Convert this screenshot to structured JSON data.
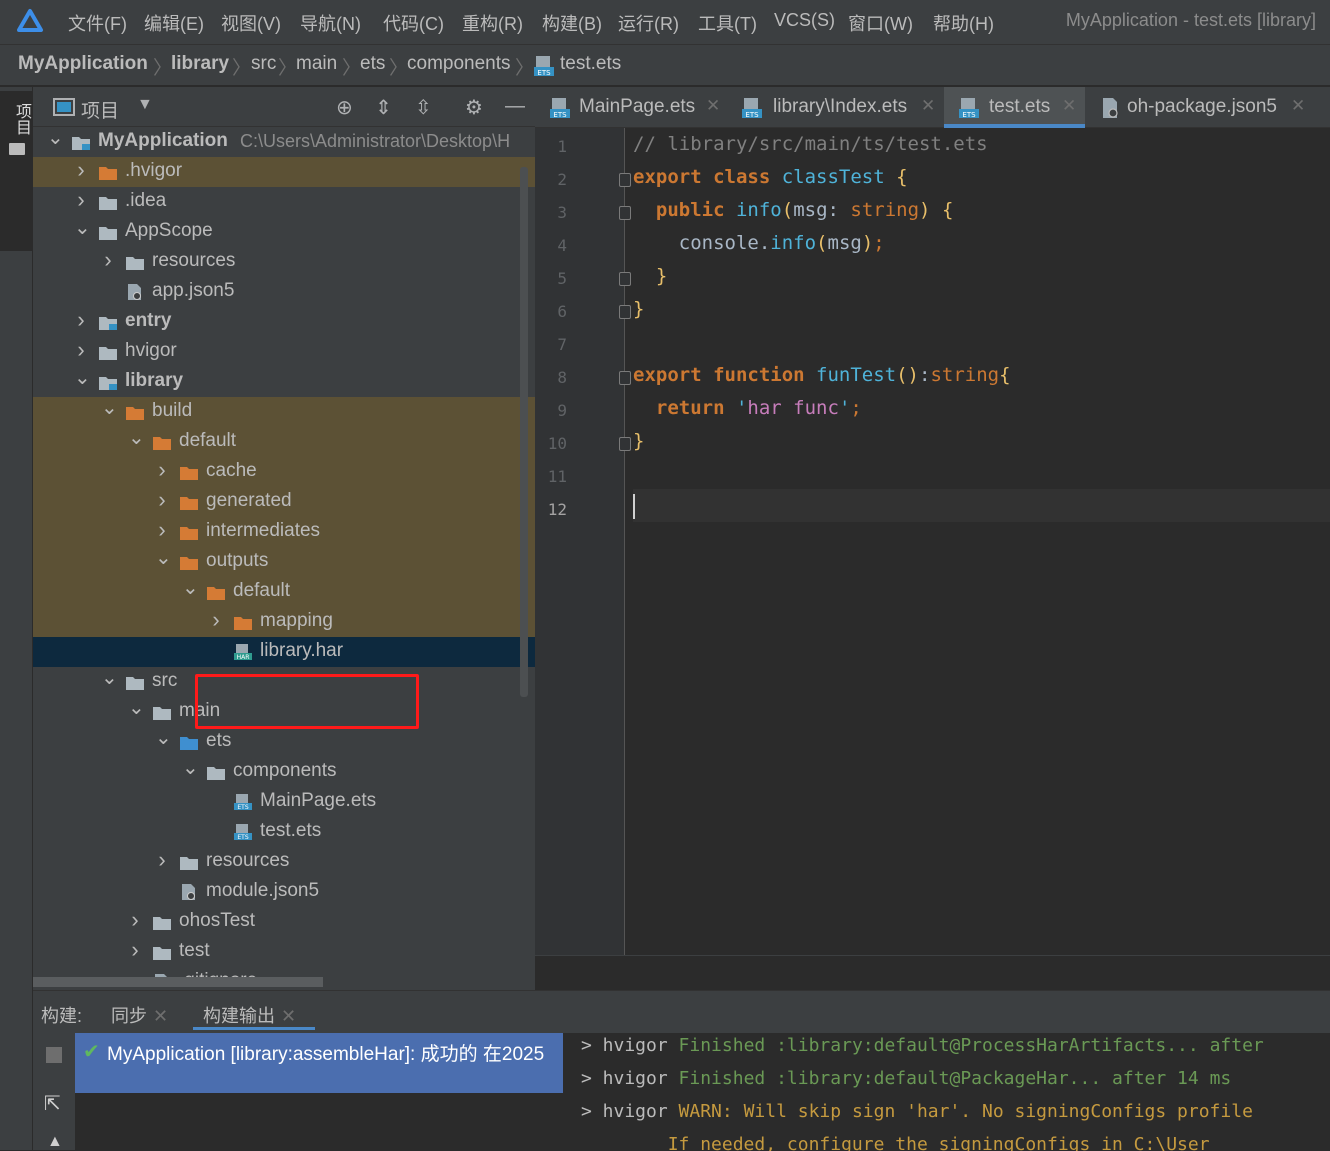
{
  "menubar": {
    "items": [
      "文件(F)",
      "编辑(E)",
      "视图(V)",
      "导航(N)",
      "代码(C)",
      "重构(R)",
      "构建(B)",
      "运行(R)",
      "工具(T)",
      "VCS(S)",
      "窗口(W)",
      "帮助(H)"
    ],
    "window_title": "MyApplication - test.ets [library]"
  },
  "breadcrumb": [
    "MyApplication",
    "library",
    "src",
    "main",
    "ets",
    "components",
    "test.ets"
  ],
  "sidebar_strip": {
    "label": "项目"
  },
  "project_panel": {
    "title": "项目",
    "tree": [
      {
        "name": "MyApplication",
        "path": "C:\\Users\\Administrator\\Desktop\\H",
        "expanded": true,
        "bold": true,
        "icon": "module-folder"
      },
      {
        "name": ".hvigor",
        "expanded": false,
        "icon": "folder-orange"
      },
      {
        "name": ".idea",
        "expanded": false,
        "icon": "folder"
      },
      {
        "name": "AppScope",
        "expanded": true,
        "icon": "folder"
      },
      {
        "name": "resources",
        "expanded": false,
        "icon": "folder"
      },
      {
        "name": "app.json5",
        "icon": "json-file"
      },
      {
        "name": "entry",
        "expanded": false,
        "bold": true,
        "icon": "module-folder"
      },
      {
        "name": "hvigor",
        "expanded": false,
        "icon": "folder"
      },
      {
        "name": "library",
        "expanded": true,
        "bold": true,
        "icon": "module-folder"
      },
      {
        "name": "build",
        "expanded": true,
        "icon": "folder-orange"
      },
      {
        "name": "default",
        "expanded": true,
        "icon": "folder-orange"
      },
      {
        "name": "cache",
        "expanded": false,
        "icon": "folder-orange"
      },
      {
        "name": "generated",
        "expanded": false,
        "icon": "folder-orange"
      },
      {
        "name": "intermediates",
        "expanded": false,
        "icon": "folder-orange"
      },
      {
        "name": "outputs",
        "expanded": true,
        "icon": "folder-orange"
      },
      {
        "name": "default",
        "expanded": true,
        "icon": "folder-orange"
      },
      {
        "name": "mapping",
        "expanded": false,
        "icon": "folder-orange"
      },
      {
        "name": "library.har",
        "icon": "har-file",
        "selected": true
      },
      {
        "name": "src",
        "expanded": true,
        "icon": "folder"
      },
      {
        "name": "main",
        "expanded": true,
        "icon": "folder"
      },
      {
        "name": "ets",
        "expanded": true,
        "icon": "folder-blue"
      },
      {
        "name": "components",
        "expanded": true,
        "icon": "folder"
      },
      {
        "name": "MainPage.ets",
        "icon": "ets-file"
      },
      {
        "name": "test.ets",
        "icon": "ets-file"
      },
      {
        "name": "resources",
        "expanded": false,
        "icon": "folder"
      },
      {
        "name": "module.json5",
        "icon": "json-file"
      },
      {
        "name": "ohosTest",
        "expanded": false,
        "icon": "folder"
      },
      {
        "name": "test",
        "expanded": false,
        "icon": "folder"
      },
      {
        "name": ".gitignore",
        "icon": "text-file"
      }
    ]
  },
  "editor": {
    "tabs": [
      {
        "label": "MainPage.ets",
        "active": false
      },
      {
        "label": "library\\Index.ets",
        "active": false
      },
      {
        "label": "test.ets",
        "active": true
      },
      {
        "label": "oh-package.json5",
        "active": false
      }
    ],
    "line_numbers": [
      "1",
      "2",
      "3",
      "4",
      "5",
      "6",
      "7",
      "8",
      "9",
      "10",
      "11",
      "12"
    ],
    "current_line": 12
  },
  "build_panel": {
    "tabs": [
      "构建:",
      "同步",
      "构建输出"
    ],
    "tree_item": "MyApplication [library:assembleHar]: 成功的 在2025",
    "output": [
      {
        "prefix": "> hvigor ",
        "status": "Finished",
        "text": " :library:default@ProcessHarArtifacts... after"
      },
      {
        "prefix": "> hvigor ",
        "status": "Finished",
        "text": " :library:default@PackageHar... after 14 ms"
      },
      {
        "prefix": "> hvigor ",
        "status": "WARN:",
        "text": " Will skip sign 'har'. No signingConfigs profile"
      },
      {
        "prefix": "",
        "status": "",
        "text": "        If needed, configure the signingConfigs in C:\\User"
      }
    ]
  },
  "colors": {
    "accent": "#4a88c7",
    "selection": "#0d293e",
    "highlight_red": "#ff1a1a",
    "excluded_bg": "#5c5135"
  }
}
